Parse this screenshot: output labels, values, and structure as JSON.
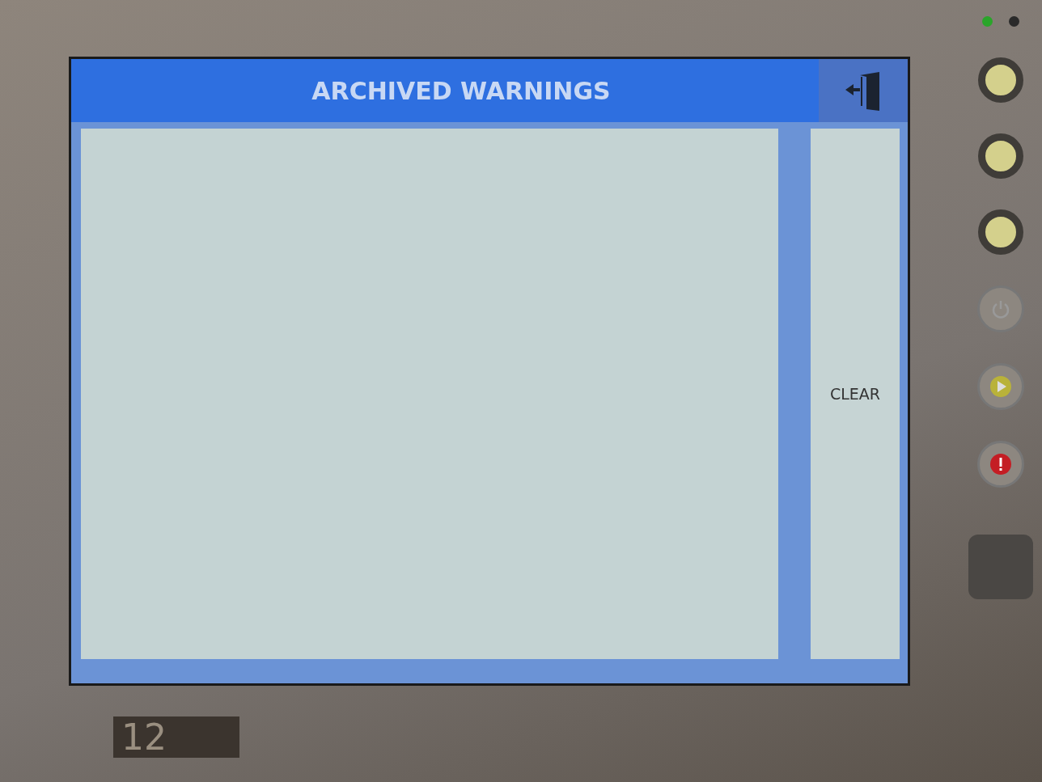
{
  "screen": {
    "title": "ARCHIVED WARNINGS",
    "clear_button": "CLEAR"
  },
  "device": {
    "leds": [
      {
        "on": true
      },
      {
        "on": false
      }
    ],
    "model_label": "12"
  }
}
